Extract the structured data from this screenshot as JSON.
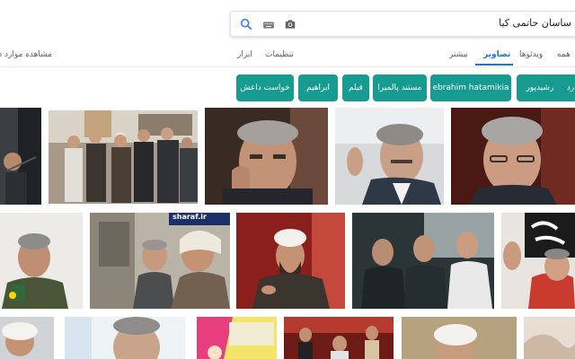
{
  "search": {
    "query": "ساسان حاتمی کیا"
  },
  "icons": {
    "search": "search-icon",
    "keyboard": "keyboard-icon",
    "camera": "camera-icon"
  },
  "tabs": {
    "all": "همه",
    "videos": "ویدئوها",
    "images": "تصاویر",
    "more": "بیشتر",
    "settings": "تنظیمات",
    "tools": "ابزار",
    "safesearch": "مشاهده موارد ذخیره"
  },
  "chips": [
    {
      "label": "رد"
    },
    {
      "label": "رشیدپور"
    },
    {
      "label": "ebrahim hatamikia"
    },
    {
      "label": "مستند پالمیرا"
    },
    {
      "label": "فیلم"
    },
    {
      "label": "ابراهیم"
    },
    {
      "label": "خواست داعش"
    }
  ],
  "image_overlays": {
    "sharaf_caption": "sharaf.ir"
  },
  "colors": {
    "accent": "#1a73e8",
    "chip_bg": "#159b8f"
  }
}
